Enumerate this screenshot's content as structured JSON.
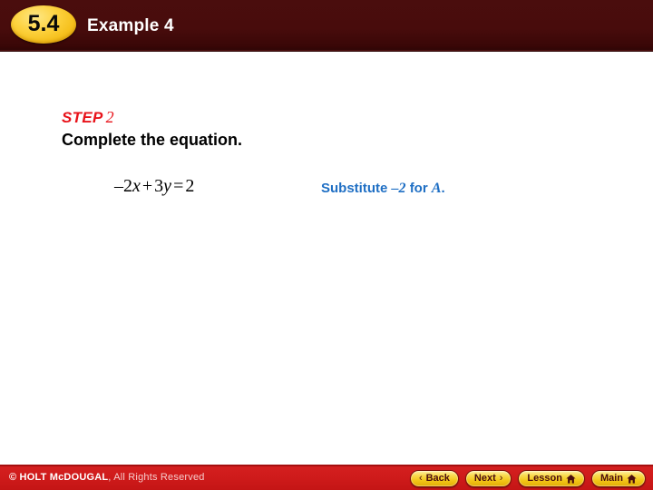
{
  "header": {
    "badge": "5.4",
    "title": "Example 4",
    "background_color": "#4a0d0d",
    "badge_color": "#f5c01c"
  },
  "slide": {
    "step": {
      "word": "STEP",
      "number": "2",
      "color": "#e8131a"
    },
    "instruction": "Complete the equation.",
    "equation": {
      "lhs_coef": "–2",
      "lhs_var": "x",
      "operator": "+",
      "rhs_coef": "3",
      "rhs_var": "y",
      "equals": "=",
      "result": "2",
      "full": "–2x + 3y = 2"
    },
    "annotation": {
      "prefix": "Substitute",
      "value": "–2",
      "middle": "for",
      "variable": "A",
      "suffix": ".",
      "color": "#1f6fc4"
    }
  },
  "footer": {
    "copyright_bold": "© HOLT McDOUGAL",
    "copyright_light": ", All Rights Reserved",
    "background_color": "#cf1b1b",
    "buttons": [
      {
        "label": "Back",
        "icon": "chevron-left-icon",
        "glyph": "‹"
      },
      {
        "label": "Next",
        "icon": "chevron-right-icon",
        "glyph": "›"
      },
      {
        "label": "Lesson",
        "icon": "home-icon",
        "glyph": ""
      },
      {
        "label": "Main",
        "icon": "home-icon",
        "glyph": ""
      }
    ]
  }
}
